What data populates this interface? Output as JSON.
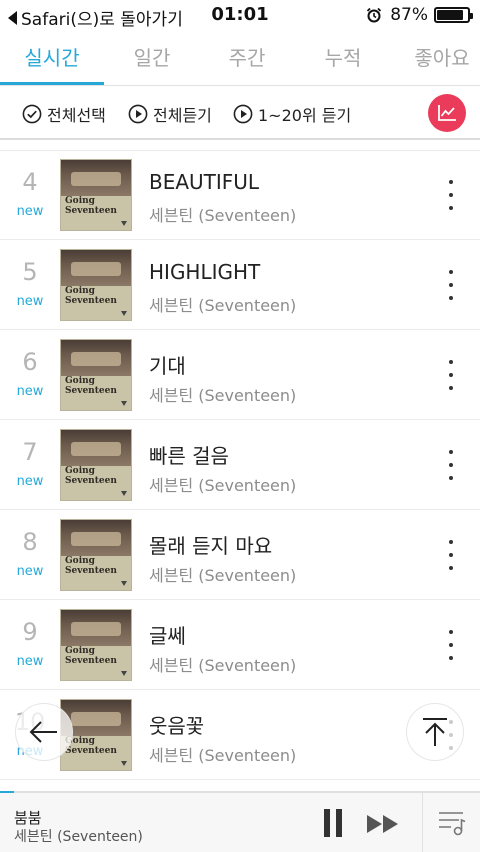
{
  "status_bar": {
    "back_label": "Safari(으)로 돌아가기",
    "time": "01:01",
    "battery": "87%",
    "battery_level": 0.87
  },
  "tabs": [
    {
      "label": "실시간"
    },
    {
      "label": "일간"
    },
    {
      "label": "주간"
    },
    {
      "label": "누적"
    },
    {
      "label": "좋아요"
    }
  ],
  "toolbar": {
    "select_all": "전체선택",
    "play_all": "전체듣기",
    "play_range": "1~20위 듣기"
  },
  "album": {
    "title_line1": "Going",
    "title_line2": "Seventeen"
  },
  "songs": [
    {
      "rank": "4",
      "badge": "new",
      "title": "BEAUTIFUL",
      "artist": "세븐틴 (Seventeen)"
    },
    {
      "rank": "5",
      "badge": "new",
      "title": "HIGHLIGHT",
      "artist": "세븐틴 (Seventeen)"
    },
    {
      "rank": "6",
      "badge": "new",
      "title": "기대",
      "artist": "세븐틴 (Seventeen)"
    },
    {
      "rank": "7",
      "badge": "new",
      "title": "빠른 걸음",
      "artist": "세븐틴 (Seventeen)"
    },
    {
      "rank": "8",
      "badge": "new",
      "title": "몰래 듣지 마요",
      "artist": "세븐틴 (Seventeen)"
    },
    {
      "rank": "9",
      "badge": "new",
      "title": "글쎄",
      "artist": "세븐틴 (Seventeen)"
    },
    {
      "rank": "10",
      "badge": "new",
      "title": "웃음꽃",
      "artist": "세븐틴 (Seventeen)"
    }
  ],
  "player": {
    "title": "붐붐",
    "artist": "세븐틴 (Seventeen)",
    "progress": 0.03
  },
  "colors": {
    "accent": "#26a9d9",
    "chart_button": "#ea3b5a"
  }
}
